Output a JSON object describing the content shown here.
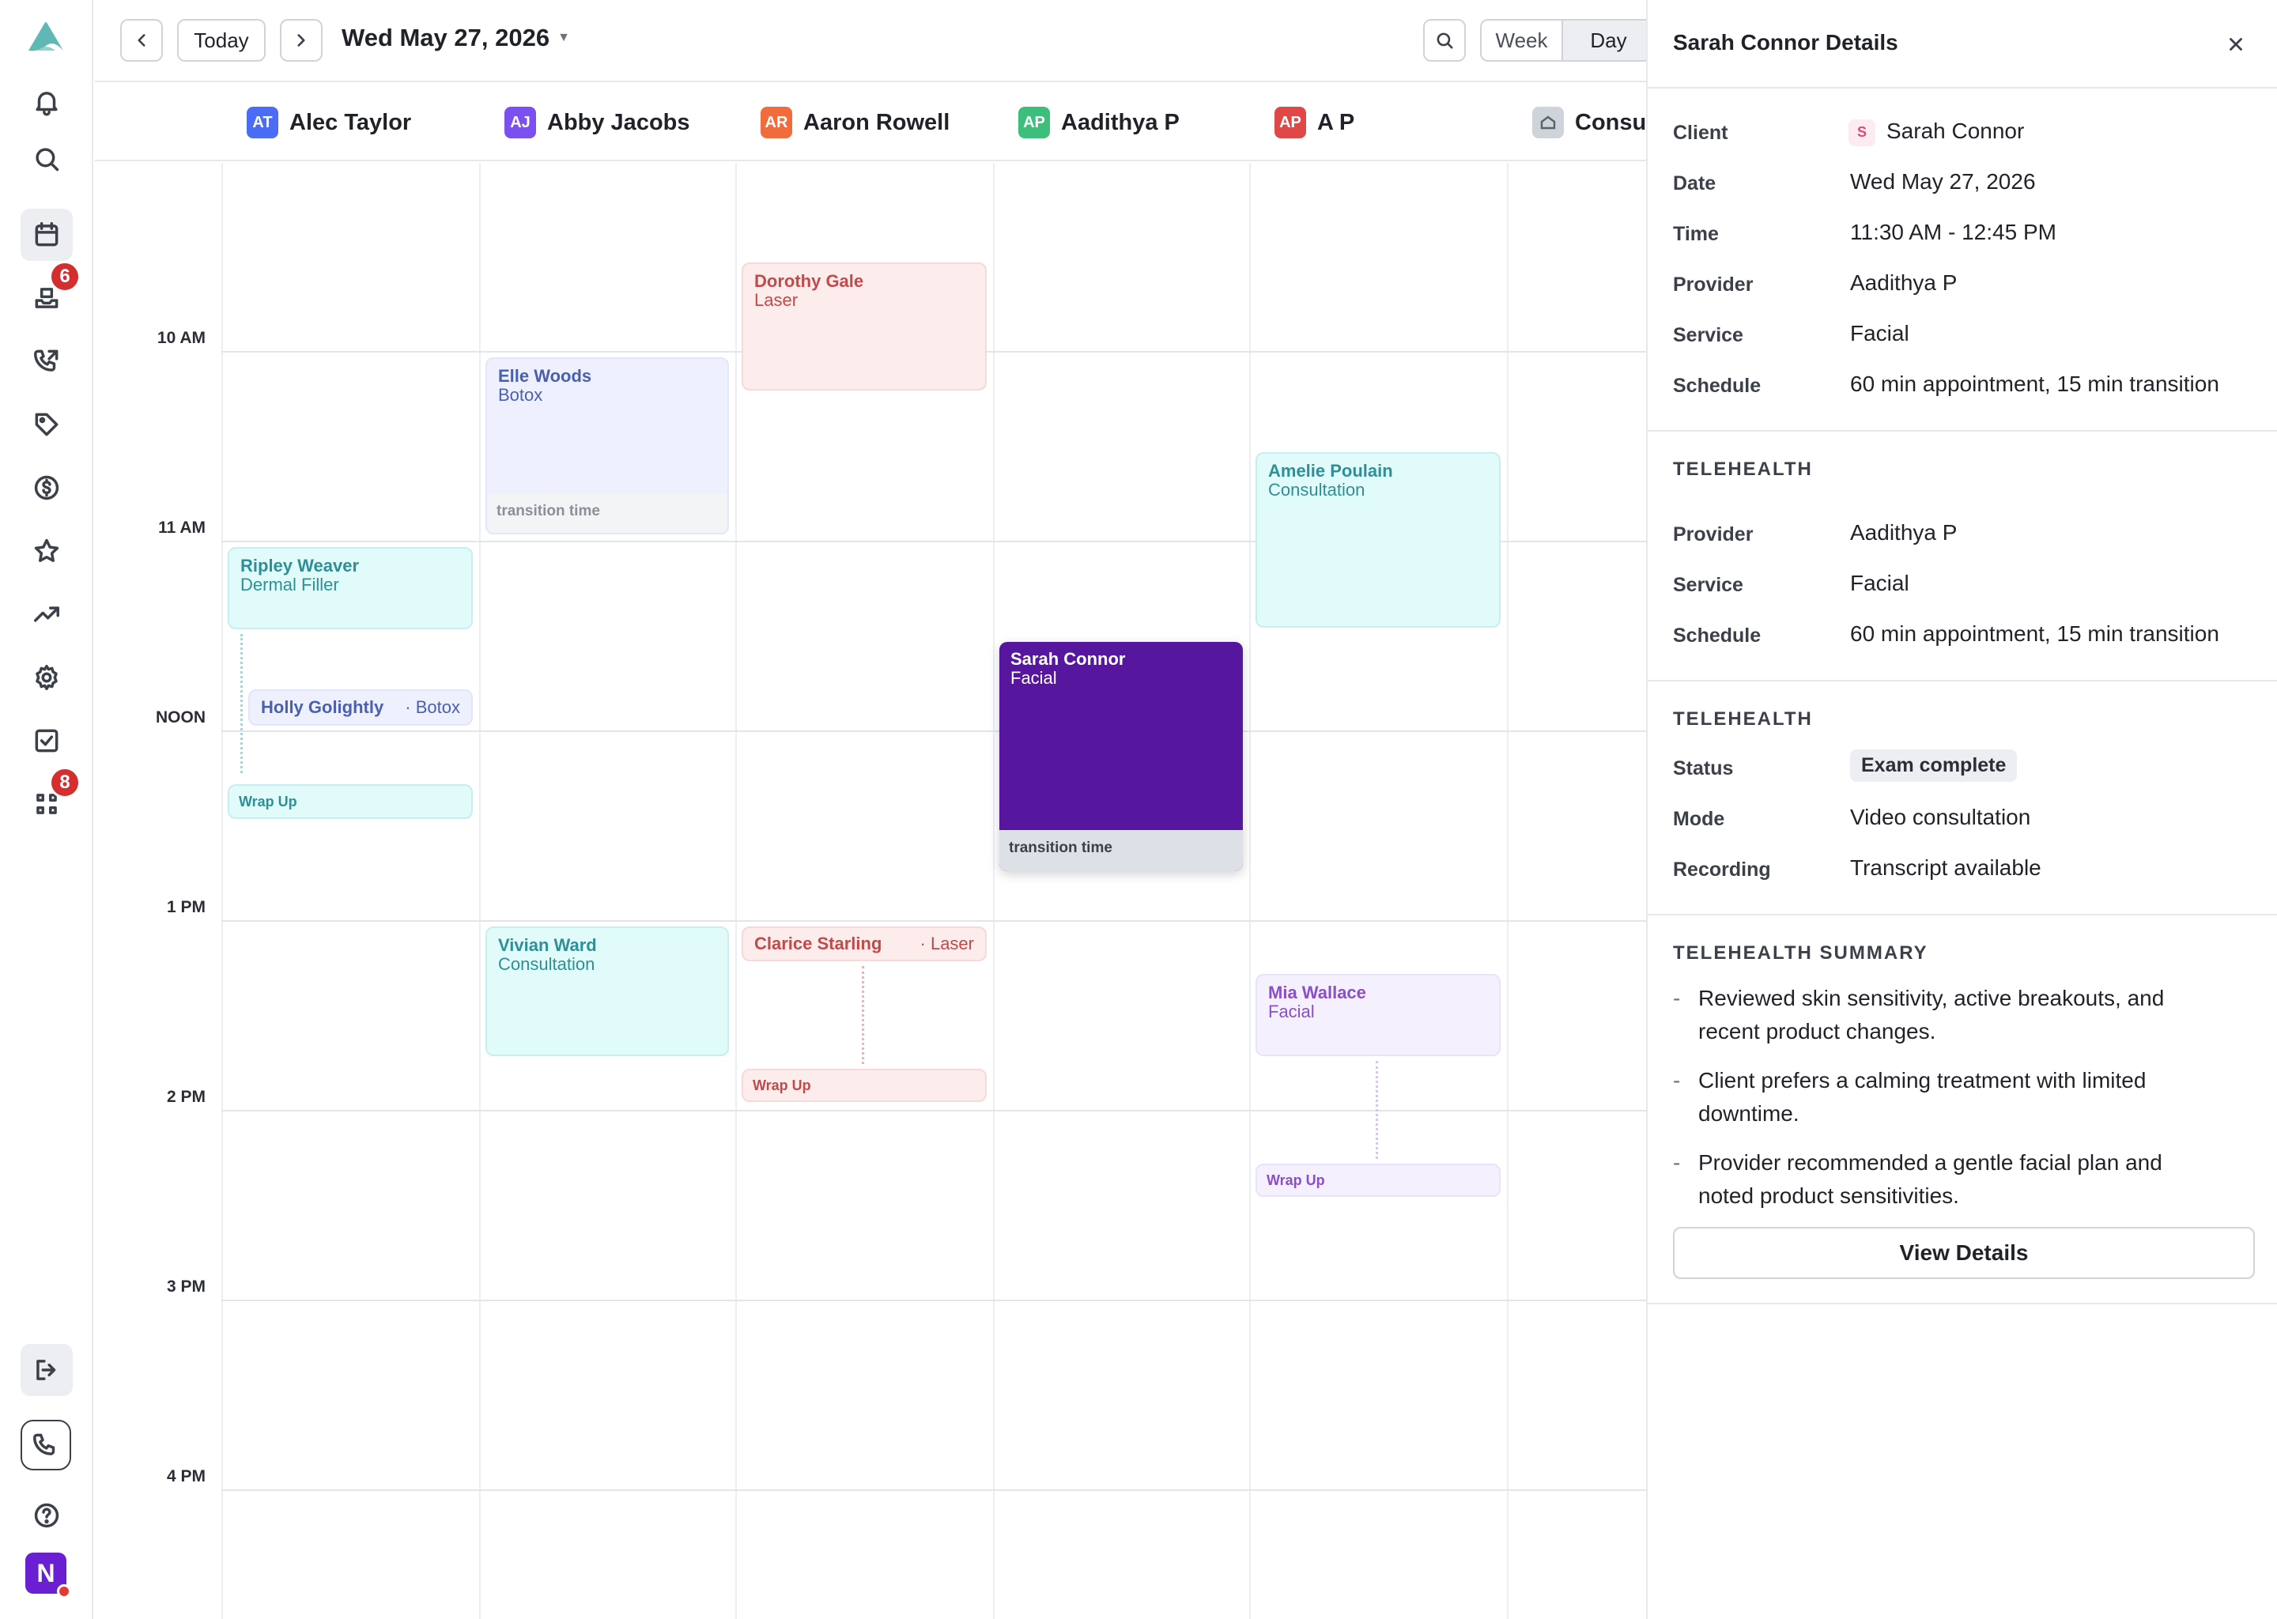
{
  "toolbar": {
    "today_label": "Today",
    "date_title": "Wed May 27, 2026",
    "week_label": "Week",
    "day_label": "Day"
  },
  "nav": {
    "inbox_badge": "6",
    "apps_badge": "8",
    "user_initial": "N"
  },
  "providers": [
    {
      "initials": "AT",
      "name": "Alec Taylor",
      "color": "#4a6cf7"
    },
    {
      "initials": "AJ",
      "name": "Abby Jacobs",
      "color": "#7b4ff0"
    },
    {
      "initials": "AR",
      "name": "Aaron Rowell",
      "color": "#f26b3a"
    },
    {
      "initials": "AP",
      "name": "Aadithya P",
      "color": "#3bbf7a"
    },
    {
      "initials": "AP",
      "name": "A P",
      "color": "#e04848"
    },
    {
      "initials": "",
      "name": "Consu",
      "color": "#cfd4da"
    }
  ],
  "times": [
    "10 AM",
    "11 AM",
    "NOON",
    "1 PM",
    "2 PM",
    "3 PM",
    "4 PM"
  ],
  "appointments": {
    "dorothy": {
      "name": "Dorothy Gale",
      "service": "Laser"
    },
    "elle": {
      "name": "Elle Woods",
      "service": "Botox",
      "transition": "transition time"
    },
    "amelie": {
      "name": "Amelie Poulain",
      "service": "Consultation"
    },
    "ripley": {
      "name": "Ripley Weaver",
      "service": "Dermal Filler"
    },
    "holly": {
      "name": "Holly Golightly",
      "service": "· Botox"
    },
    "alec_wrap": {
      "label": "Wrap Up"
    },
    "sarah": {
      "name": "Sarah Connor",
      "service": "Facial",
      "transition": "transition time"
    },
    "vivian": {
      "name": "Vivian Ward",
      "service": "Consultation"
    },
    "clarice": {
      "name": "Clarice Starling",
      "service": "· Laser"
    },
    "clarice_wrap": {
      "label": "Wrap Up"
    },
    "mia": {
      "name": "Mia Wallace",
      "service": "Facial"
    },
    "mia_wrap": {
      "label": "Wrap Up"
    }
  },
  "panel": {
    "title": "Sarah Connor Details",
    "details": {
      "client_label": "Client",
      "client_initial": "S",
      "client_value": "Sarah Connor",
      "date_label": "Date",
      "date_value": "Wed May 27, 2026",
      "time_label": "Time",
      "time_value": "11:30 AM - 12:45 PM",
      "provider_label": "Provider",
      "provider_value": "Aadithya P",
      "service_label": "Service",
      "service_value": "Facial",
      "schedule_label": "Schedule",
      "schedule_value": "60 min appointment, 15 min transition"
    },
    "telehealth1": {
      "title": "TELEHEALTH",
      "provider_label": "Provider",
      "provider_value": "Aadithya P",
      "service_label": "Service",
      "service_value": "Facial",
      "schedule_label": "Schedule",
      "schedule_value": "60 min appointment, 15 min transition"
    },
    "telehealth2": {
      "title": "TELEHEALTH",
      "status_label": "Status",
      "status_value": "Exam complete",
      "mode_label": "Mode",
      "mode_value": "Video consultation",
      "recording_label": "Recording",
      "recording_value": "Transcript available"
    },
    "summary": {
      "title": "TELEHEALTH SUMMARY",
      "items": [
        {
          "dash": "-",
          "line1": "Reviewed skin sensitivity, active breakouts, and",
          "line2": "recent product changes."
        },
        {
          "dash": "-",
          "line1": "Client prefers a calming treatment with limited",
          "line2": "downtime."
        },
        {
          "dash": "-",
          "line1": "Provider recommended a gentle facial plan and",
          "line2": "noted product sensitivities."
        }
      ]
    },
    "view_details_label": "View Details"
  }
}
